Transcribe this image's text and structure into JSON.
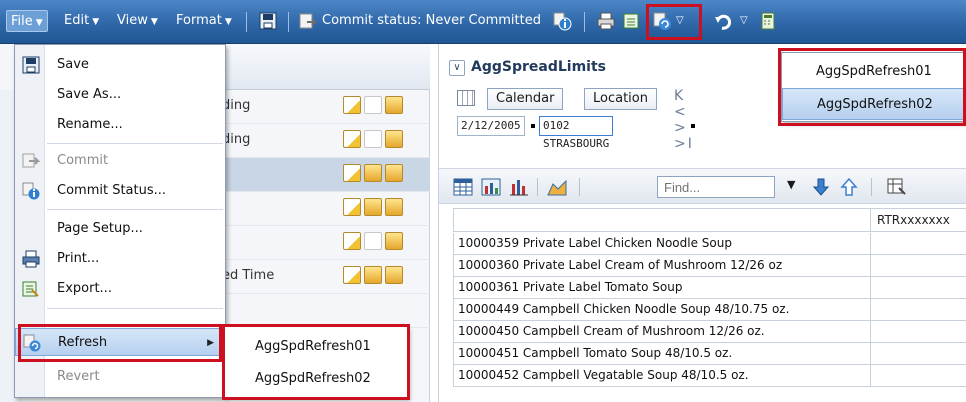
{
  "toolbar": {
    "menus": [
      {
        "label": "File",
        "accel": "F"
      },
      {
        "label": "Edit",
        "accel": "E"
      },
      {
        "label": "View",
        "accel": "V"
      },
      {
        "label": "Format",
        "accel": "o"
      }
    ],
    "commit_status": "Commit status: Never Committed"
  },
  "left_panel": {
    "rows": [
      {
        "text": "ding"
      },
      {
        "text": "ding"
      },
      {
        "text": ""
      },
      {
        "text": ""
      },
      {
        "text": ""
      },
      {
        "text": "ed Time"
      },
      {
        "text": ""
      }
    ]
  },
  "file_menu": {
    "items": [
      {
        "label": "Save",
        "icon": "save-icon",
        "disabled": false
      },
      {
        "label": "Save As...",
        "icon": "",
        "disabled": false
      },
      {
        "label": "Rename...",
        "icon": "",
        "disabled": false
      },
      {
        "label": "Commit",
        "icon": "commit-icon",
        "disabled": true
      },
      {
        "label": "Commit Status...",
        "icon": "commit-status-icon",
        "disabled": false
      },
      {
        "label": "Page Setup...",
        "icon": "",
        "disabled": false
      },
      {
        "label": "Print...",
        "icon": "print-icon",
        "disabled": false
      },
      {
        "label": "Export...",
        "icon": "export-icon",
        "disabled": false
      },
      {
        "label": "Refresh",
        "icon": "refresh-icon",
        "disabled": false
      },
      {
        "label": "Revert",
        "icon": "",
        "disabled": true
      }
    ],
    "refresh_submenu": [
      "AggSpdRefresh01",
      "AggSpdRefresh02"
    ]
  },
  "toolbar_refresh_dropdown": [
    "AggSpdRefresh01",
    "AggSpdRefresh02"
  ],
  "form": {
    "title": "AggSpreadLimits",
    "dimensions": [
      "Calendar",
      "Location"
    ],
    "pager": "K < > >I",
    "pov": [
      "2/12/2005",
      "0102 STRASBOURG"
    ],
    "find_placeholder": "Find...",
    "column_header": "RTRxxxxxxx",
    "rows": [
      "10000359 Private Label Chicken Noodle Soup",
      "10000360 Private Label Cream of Mushroom 12/26 oz",
      "10000361 Private Label Tomato Soup",
      "10000449 Campbell Chicken Noodle Soup 48/10.75 oz.",
      "10000450 Campbell Cream of Mushroom 12/26 oz.",
      "10000451 Campbell Tomato Soup 48/10.5 oz.",
      "10000452 Campbell Vegatable Soup 48/10.5 oz."
    ]
  },
  "colors": {
    "toolbar": "#2f67a8",
    "highlight": "#b6d0ef",
    "annotation": "#cc1020"
  }
}
